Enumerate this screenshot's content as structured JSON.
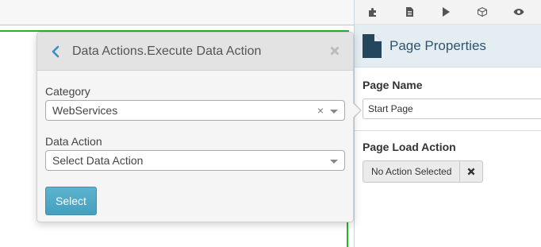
{
  "toolbar": {
    "icons": [
      "puzzle-icon",
      "file-icon",
      "play-icon",
      "cube-icon",
      "eye-icon"
    ]
  },
  "properties": {
    "title": "Page Properties",
    "page_name_label": "Page Name",
    "page_name_value": "Start Page",
    "page_load_label": "Page Load Action",
    "page_load_value": "No Action Selected"
  },
  "dialog": {
    "title": "Data Actions.Execute Data Action",
    "category_label": "Category",
    "category_value": "WebServices",
    "clear_glyph": "×",
    "data_action_label": "Data Action",
    "data_action_value": "Select Data Action",
    "select_button": "Select"
  },
  "colors": {
    "accent_green": "#28b428",
    "button_blue": "#4aa3c3",
    "header_blue": "#e4edf2",
    "title_blue": "#2e5570"
  }
}
